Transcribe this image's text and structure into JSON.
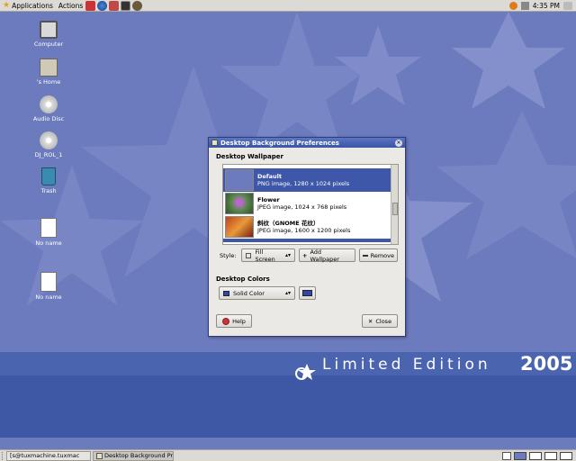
{
  "top_panel": {
    "applications": "Applications",
    "actions": "Actions",
    "clock": "4:35 PM"
  },
  "desktop_icons": {
    "computer": "Computer",
    "home": "'s Home",
    "audio_disc": "Audio Disc",
    "dvd": "DJ_ROL_1",
    "trash": "Trash",
    "file1": "No name",
    "file2": "No name"
  },
  "branding": {
    "edition": "Limited Edition",
    "year": "2005"
  },
  "dialog": {
    "title": "Desktop Background Preferences",
    "wallpaper_section": "Desktop Wallpaper",
    "wallpapers": [
      {
        "name": "Default",
        "info": "PNG image, 1280 x 1024 pixels"
      },
      {
        "name": "Flower",
        "info": "JPEG image, 1024 x 768 pixels"
      },
      {
        "name": "斜纹（GNOME 花纹）",
        "info": "JPEG image, 1600 x 1200 pixels"
      }
    ],
    "style_label": "Style:",
    "style_value": "Fill Screen",
    "add_wallpaper": "Add Wallpaper",
    "remove": "Remove",
    "colors_section": "Desktop Colors",
    "color_mode": "Solid Color",
    "swatch_color": "#3048a0",
    "help": "Help",
    "close": "Close"
  },
  "bottom_panel": {
    "task_terminal": "[s@tuxmachine.tuxmac",
    "task_dialog": "Desktop Background Pre"
  },
  "colors": {
    "desktop": "#6c7bbd",
    "selection": "#3f57a8",
    "band": "#3f58a6"
  }
}
